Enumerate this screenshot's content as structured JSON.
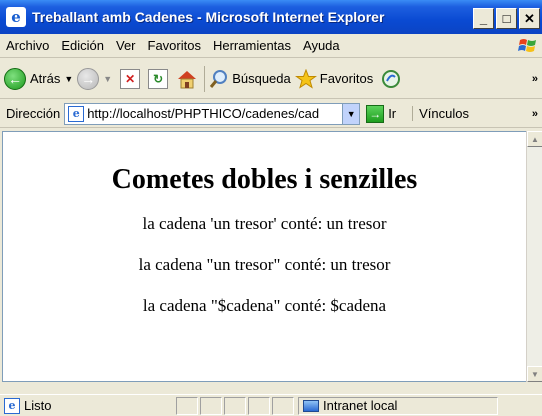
{
  "window": {
    "title": "Treballant amb Cadenes - Microsoft Internet Explorer",
    "min_label": "_",
    "max_label": "□",
    "close_label": "✕"
  },
  "menu": {
    "items": [
      {
        "label": "Archivo"
      },
      {
        "label": "Edición"
      },
      {
        "label": "Ver"
      },
      {
        "label": "Favoritos"
      },
      {
        "label": "Herramientas"
      },
      {
        "label": "Ayuda"
      }
    ]
  },
  "toolbar": {
    "back_label": "Atrás",
    "search_label": "Búsqueda",
    "favorites_label": "Favoritos",
    "more": "»"
  },
  "address": {
    "label": "Dirección",
    "url": "http://localhost/PHPTHICO/cadenes/cad",
    "go_label": "Ir",
    "links_label": "Vínculos",
    "more": "»"
  },
  "page": {
    "heading": "Cometes dobles i senzilles",
    "lines": [
      "la cadena 'un tresor' conté: un tresor",
      "la cadena \"un tresor\" conté: un tresor",
      "la cadena \"$cadena\" conté: $cadena"
    ]
  },
  "status": {
    "text": "Listo",
    "zone": "Intranet local"
  },
  "icons": {
    "back": "back-arrow-icon",
    "forward": "forward-arrow-icon",
    "stop": "stop-icon",
    "refresh": "refresh-icon",
    "home": "home-icon",
    "search": "search-icon",
    "favorites": "star-icon",
    "media": "media-icon"
  },
  "colors": {
    "titlebar": "#0a4ad2",
    "chrome": "#ece9d8"
  }
}
